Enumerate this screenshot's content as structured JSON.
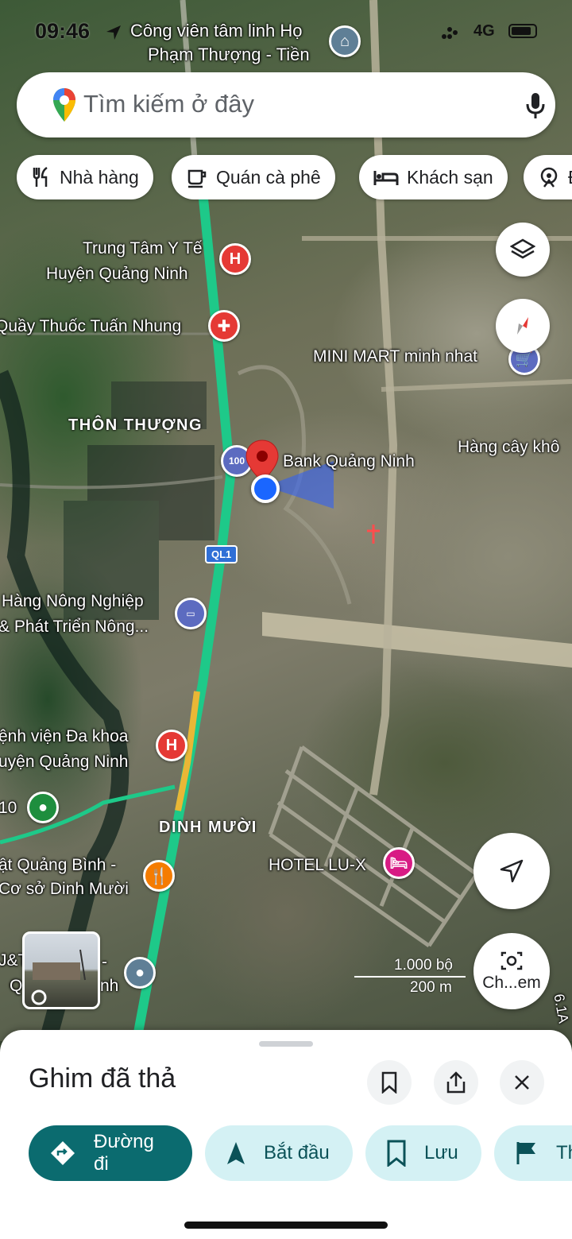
{
  "status_bar": {
    "time": "09:46",
    "network": "4G"
  },
  "search": {
    "placeholder": "Tìm kiếm ở đây"
  },
  "chips": [
    {
      "label": "Nhà hàng",
      "icon": "restaurant-icon"
    },
    {
      "label": "Quán cà phê",
      "icon": "coffee-icon"
    },
    {
      "label": "Khách sạn",
      "icon": "hotel-icon"
    },
    {
      "label": "Đ",
      "icon": "attraction-icon"
    }
  ],
  "map": {
    "labels": {
      "cong_vien_1": "Công viên tâm linh Họ",
      "cong_vien_2": "Phạm Thượng - Tiền",
      "trung_tam_1": "Trung Tâm Y Tế",
      "trung_tam_2": "Huyện Quảng Ninh",
      "quay_thuoc": "Quầy Thuốc Tuấn Nhung",
      "mini_mart": "MINI MART minh nhat",
      "thon_thuong": "THÔN THƯỢNG",
      "hang_cay": "Hàng cây khô",
      "bank": "Bank Quảng Ninh",
      "road_badge": "QL1",
      "nong_nghiep_1": "Hàng Nông Nghiệp",
      "nong_nghiep_2": "& Phát Triển Nông...",
      "benh_vien_1": "ệnh viện Đa khoa",
      "benh_vien_2": "uyện Quảng Ninh",
      "green_poi": "10",
      "dinh_muoi": "DINH MƯỜI",
      "hotel": "HOTEL LU-X",
      "quang_binh_1": "ật Quảng Bình -",
      "quang_binh_2": "Cơ sở Dinh Mười",
      "jt_1": "J&T",
      "jt_2": "Q",
      "jt_3": "-",
      "jt_4": "nh",
      "road_right": "6.1A",
      "atm_badge": "100"
    },
    "scale": {
      "feet": "1.000 bộ",
      "meters": "200 m"
    },
    "explore_button": "Ch...em"
  },
  "sheet": {
    "title": "Ghim đã thả",
    "actions": [
      {
        "label": "Đường đi",
        "icon": "directions-icon"
      },
      {
        "label": "Bắt đầu",
        "icon": "navigation-arrow-icon"
      },
      {
        "label": "Lưu",
        "icon": "bookmark-icon"
      },
      {
        "label": "Th",
        "icon": "flag-icon"
      }
    ]
  },
  "colors": {
    "primary": "#0b6b6f",
    "secondary": "#d4f1f4",
    "route": "#1ec989",
    "pin": "#e53935",
    "location": "#1a66ff"
  }
}
